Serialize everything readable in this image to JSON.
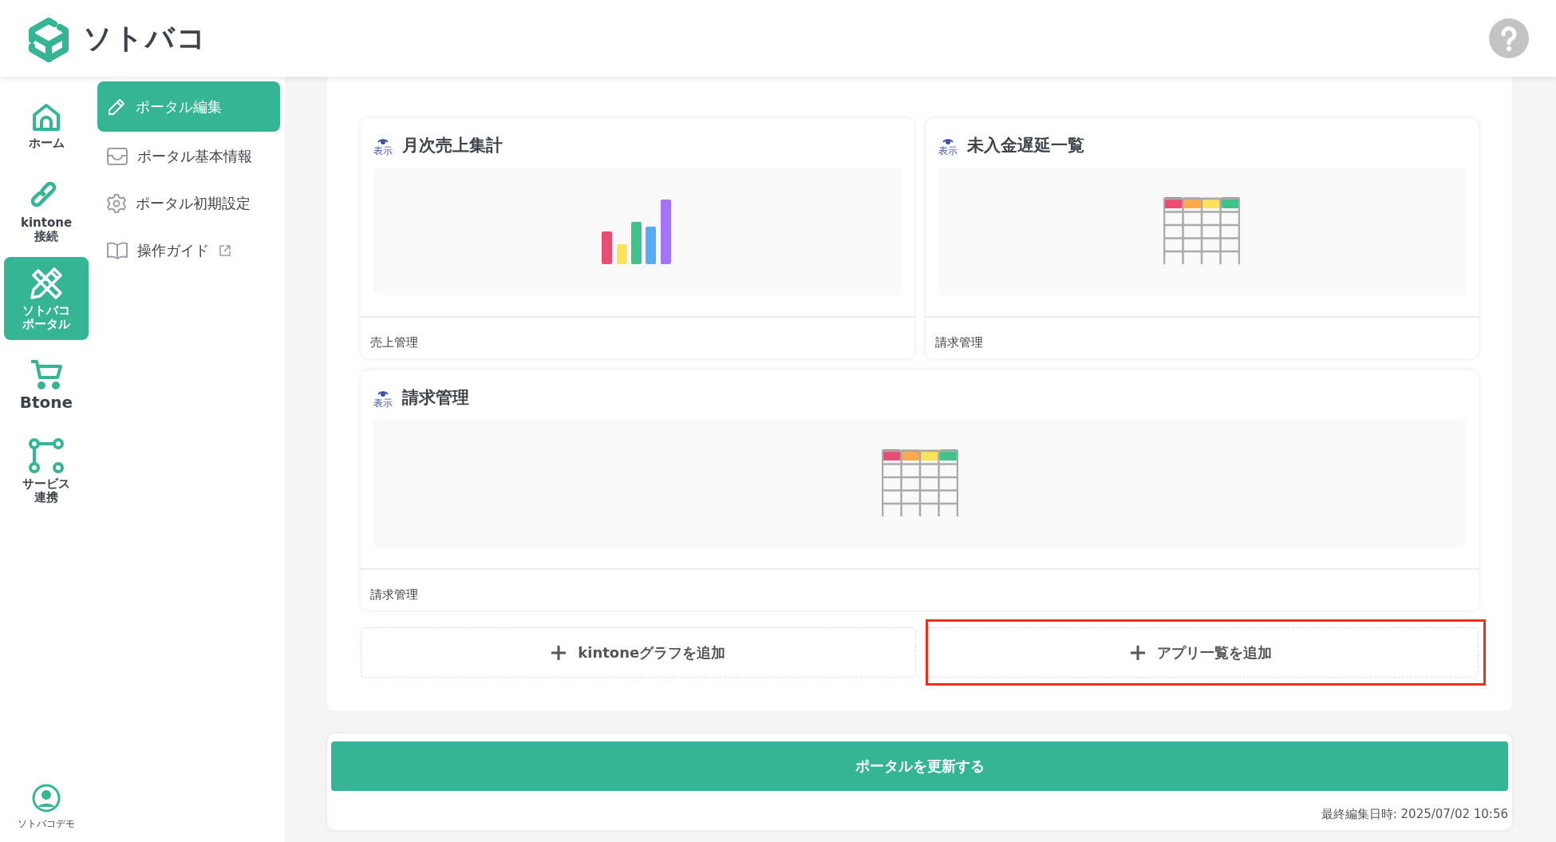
{
  "header": {
    "logo_text": "ソトバコ"
  },
  "rail": [
    {
      "label": "ホーム",
      "selected": false
    },
    {
      "label": "kintone接続",
      "selected": false
    },
    {
      "label": "ソトバコポータル",
      "selected": true
    },
    {
      "label": "Btone",
      "selected": false
    },
    {
      "label": "サービス連携",
      "selected": false
    }
  ],
  "user": {
    "name": "ソトバコデモ"
  },
  "subnav": [
    {
      "label": "ポータル編集",
      "selected": true,
      "external": false
    },
    {
      "label": "ポータル基本情報",
      "selected": false,
      "external": false
    },
    {
      "label": "ポータル初期設定",
      "selected": false,
      "external": false
    },
    {
      "label": "操作ガイド",
      "selected": false,
      "external": true
    }
  ],
  "widgets": [
    {
      "title": "月次売上集計",
      "kind": "graph",
      "visibility_label": "表示",
      "visible": true,
      "app": "売上管理",
      "wide": false
    },
    {
      "title": "未入金遅延一覧",
      "kind": "list",
      "visibility_label": "表示",
      "visible": true,
      "app": "請求管理",
      "wide": false
    },
    {
      "title": "請求管理",
      "kind": "list",
      "visibility_label": "表示",
      "visible": true,
      "app": "請求管理",
      "wide": true
    }
  ],
  "add_buttons": [
    {
      "label": "kintoneグラフを追加",
      "highlighted": false
    },
    {
      "label": "アプリ一覧を追加",
      "highlighted": true
    }
  ],
  "update_button": "ポータルを更新する",
  "last_edited": "最終編集日時: 2025/07/02 10:56"
}
